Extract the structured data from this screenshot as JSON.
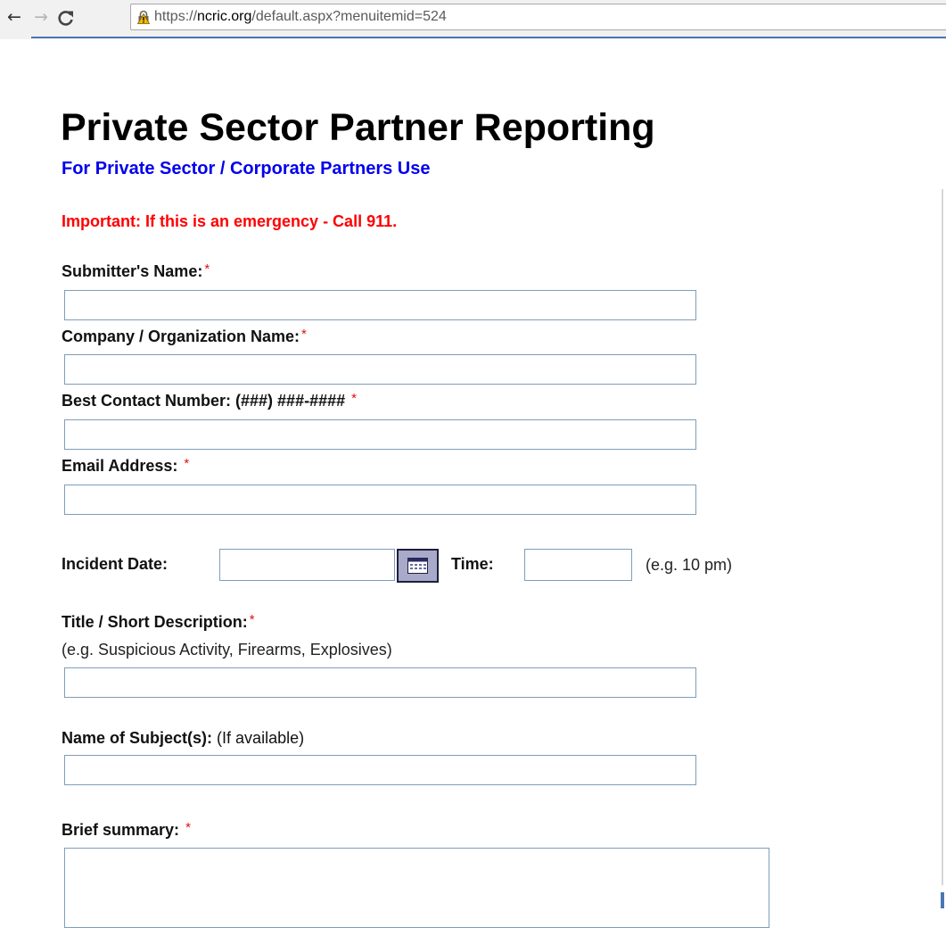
{
  "browser": {
    "back_icon": "arrow-left",
    "forward_icon": "arrow-right",
    "reload_icon": "reload",
    "url_scheme": "https://",
    "url_host": "ncric.org",
    "url_path": "/default.aspx?menuitemid=524",
    "colors": {
      "accent_rule": "#4877b5",
      "warning_icon": "#e0a800"
    }
  },
  "page": {
    "title": "Private Sector Partner Reporting",
    "subtitle": "For Private Sector / Corporate Partners Use",
    "important": "Important: If this is an emergency - Call 911.",
    "colors": {
      "subtitle": "#0000ee",
      "important": "#ff0000",
      "required": "#e01010"
    }
  },
  "form": {
    "required_mark": "*",
    "submitter_label": "Submitter's Name:",
    "submitter_value": "",
    "company_label": "Company / Organization Name:",
    "company_value": "",
    "phone_label": "Best Contact Number: (###) ###-####",
    "phone_value": "",
    "email_label": "Email Address:",
    "email_value": "",
    "date_label": "Incident Date:",
    "date_value": "",
    "calendar_icon": "calendar-icon",
    "time_label": "Time:",
    "time_value": "",
    "time_hint": "(e.g. 10 pm)",
    "title_label": "Title / Short Description:",
    "title_hint": "(e.g. Suspicious Activity, Firearms, Explosives)",
    "title_value": "",
    "subject_label": "Name of Subject(s):",
    "subject_hint": "(If available)",
    "subject_value": "",
    "summary_label": "Brief summary:",
    "summary_value": ""
  }
}
